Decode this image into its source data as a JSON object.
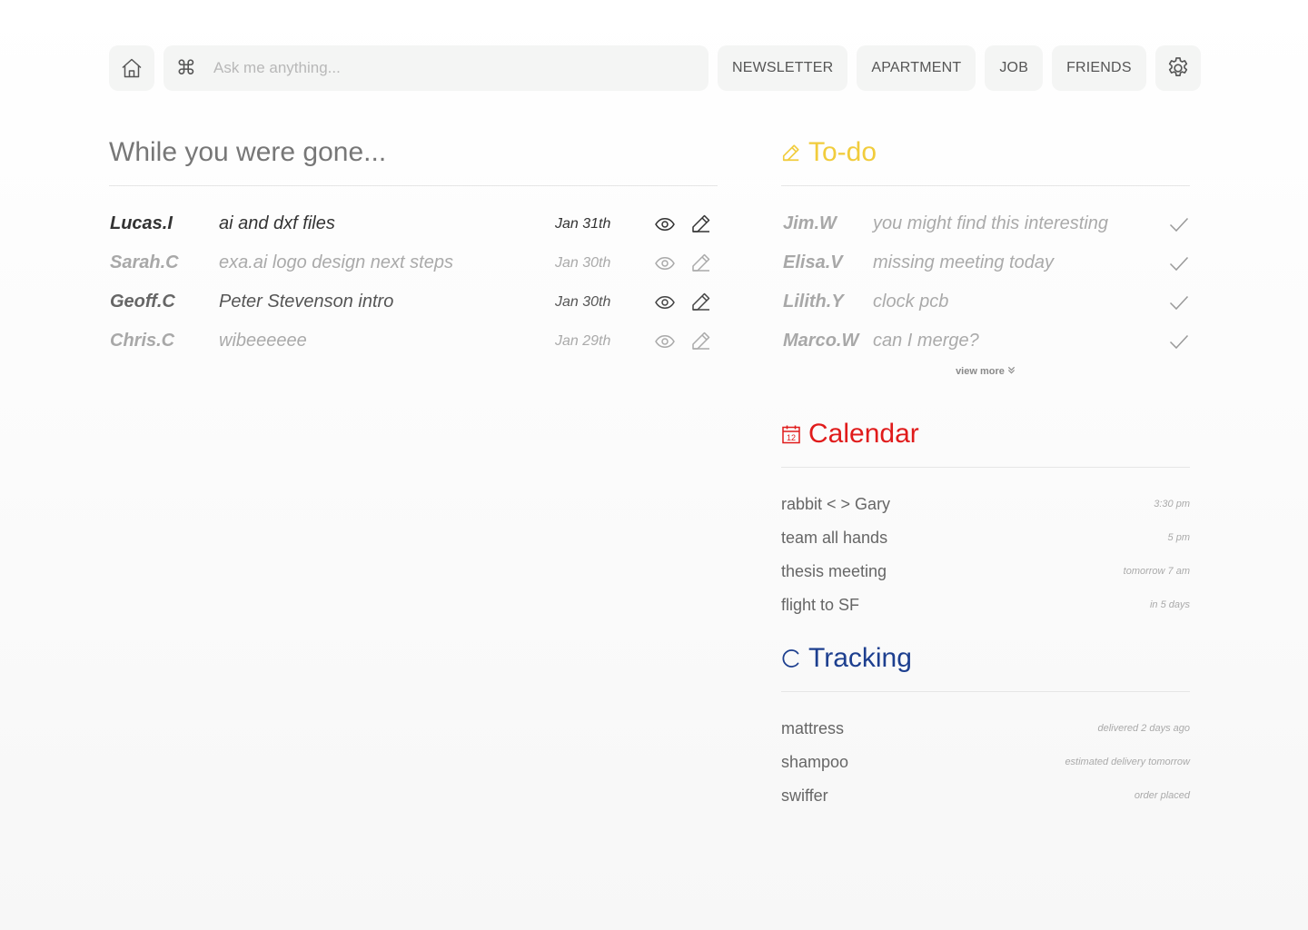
{
  "search": {
    "placeholder": "Ask me anything..."
  },
  "nav": [
    "NEWSLETTER",
    "APARTMENT",
    "JOB",
    "FRIENDS"
  ],
  "feed": {
    "heading": "While you were gone...",
    "messages": [
      {
        "name": "Lucas.I",
        "subject": "ai and dxf files",
        "date": "Jan 31th",
        "state": "unread"
      },
      {
        "name": "Sarah.C",
        "subject": "exa.ai logo design next steps",
        "date": "Jan 30th",
        "state": "read"
      },
      {
        "name": "Geoff.C",
        "subject": "Peter Stevenson intro",
        "date": "Jan 30th",
        "state": "unread"
      },
      {
        "name": "Chris.C",
        "subject": "wibeeeeee",
        "date": "Jan 29th",
        "state": "read"
      }
    ]
  },
  "todo": {
    "title": "To-do",
    "items": [
      {
        "name": "Jim.W",
        "subject": "you might find this interesting"
      },
      {
        "name": "Elisa.V",
        "subject": "missing meeting today"
      },
      {
        "name": "Lilith.Y",
        "subject": "clock pcb"
      },
      {
        "name": "Marco.W",
        "subject": "can I merge?"
      }
    ],
    "view_more": "view more"
  },
  "calendar": {
    "title": "Calendar",
    "icon_number": "12",
    "events": [
      {
        "label": "rabbit < > Gary",
        "when": "3:30 pm"
      },
      {
        "label": "team all hands",
        "when": "5 pm"
      },
      {
        "label": "thesis meeting",
        "when": "tomorrow 7 am"
      },
      {
        "label": "flight to SF",
        "when": "in 5 days"
      }
    ]
  },
  "tracking": {
    "title": "Tracking",
    "items": [
      {
        "label": "mattress",
        "status": "delivered 2 days ago"
      },
      {
        "label": "shampoo",
        "status": "estimated delivery tomorrow"
      },
      {
        "label": "swiffer",
        "status": "order placed"
      }
    ]
  },
  "colors": {
    "todo": "#f1cc3c",
    "calendar": "#e01b1b",
    "tracking": "#1d3f8f",
    "chip_bg": "#f4f5f4"
  },
  "icons": [
    "home-icon",
    "command-icon",
    "gear-icon",
    "eye-icon",
    "pencil-icon",
    "check-icon",
    "calendar-icon",
    "loading-arc-icon",
    "chevron-double-down-icon"
  ]
}
